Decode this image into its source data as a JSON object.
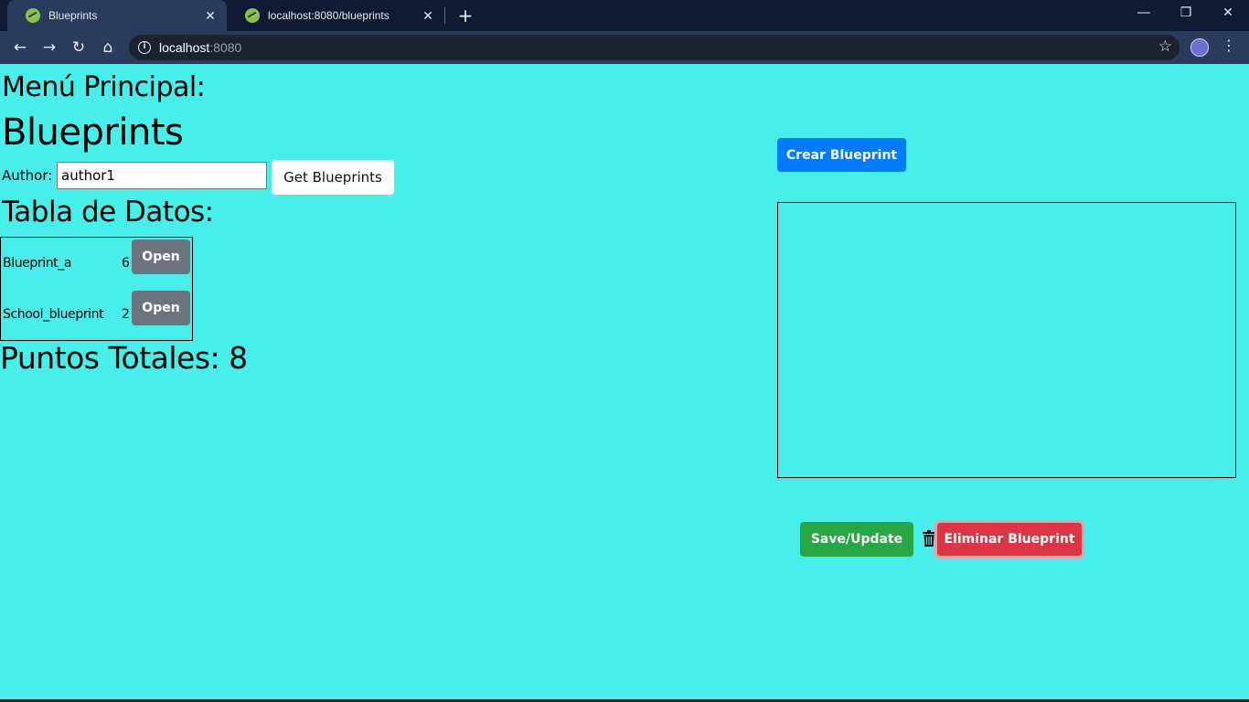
{
  "browser": {
    "tabs": [
      {
        "title": "Blueprints",
        "active": true
      },
      {
        "title": "localhost:8080/blueprints",
        "active": false
      }
    ],
    "url_host": "localhost",
    "url_port": ":8080",
    "icons": {
      "favicon": "spring-leaf-icon",
      "back": "arrow-left-icon",
      "forward": "arrow-right-icon",
      "reload": "reload-icon",
      "home": "home-icon",
      "info": "info-icon",
      "bookmark": "star-icon",
      "menu": "vertical-dots-icon"
    }
  },
  "page": {
    "menu_heading": "Menú Principal:",
    "title": "Blueprints",
    "author_label": "Author:",
    "author_value": "author1",
    "get_button": "Get Blueprints",
    "table_heading": "Tabla de Datos:",
    "rows": [
      {
        "name": "Blueprint_a",
        "points": "6",
        "action": "Open"
      },
      {
        "name": "School_blueprint",
        "points": "2",
        "action": "Open"
      }
    ],
    "total_points": "Puntos Totales: 8",
    "create_button": "Crear Blueprint",
    "save_button": "Save/Update",
    "delete_button": "Eliminar Blueprint"
  },
  "colors": {
    "page_background": "#47eeea",
    "primary": "#007bff",
    "secondary": "#6c757d",
    "success": "#28a745",
    "danger": "#dc3545"
  }
}
